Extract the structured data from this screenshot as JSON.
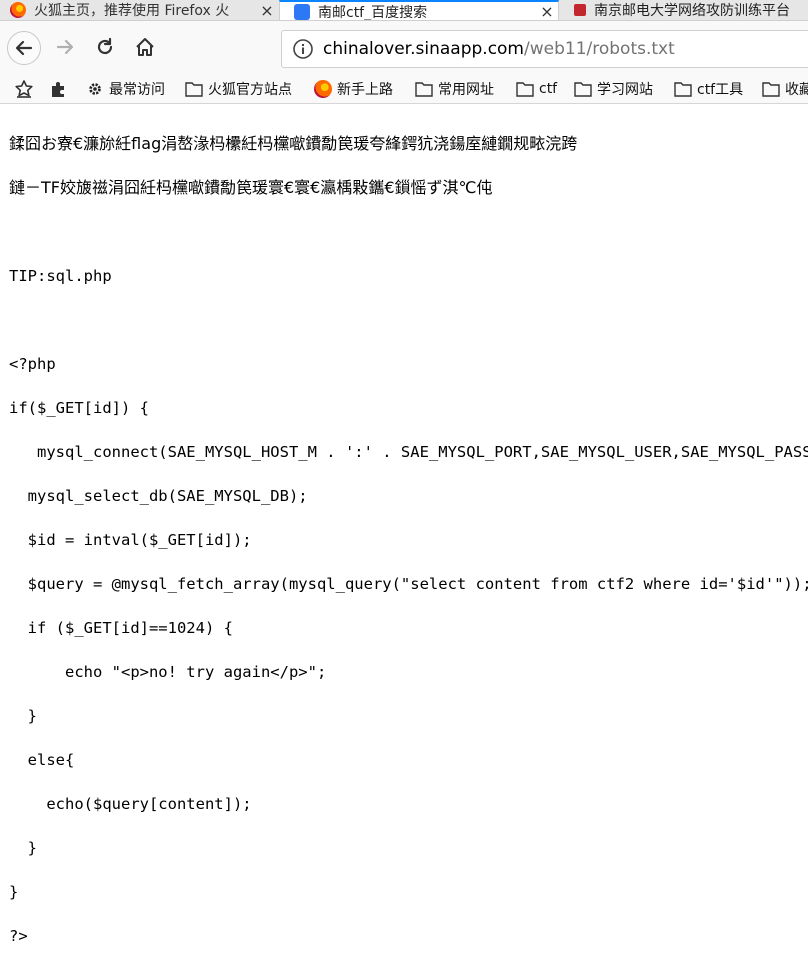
{
  "tabs": [
    {
      "title": "火狐主页，推荐使用 Firefox 火",
      "close": "×",
      "active": false,
      "icon": "firefox-icon"
    },
    {
      "title": "南邮ctf_百度搜索",
      "close": "×",
      "active": true,
      "icon": "baidu-icon"
    },
    {
      "title": "南京邮电大学网络攻防训练平台",
      "active": false,
      "icon": "site-icon"
    }
  ],
  "nav": {
    "url_host": "chinalover.sinaapp.com",
    "url_path": "/web11/robots.txt"
  },
  "bookmarks": [
    {
      "label": "最常访问",
      "icon": "gear-icon"
    },
    {
      "label": "火狐官方站点",
      "icon": "folder-icon"
    },
    {
      "label": "新手上路",
      "icon": "firefox-icon"
    },
    {
      "label": "常用网址",
      "icon": "folder-icon"
    },
    {
      "label": "ctf",
      "icon": "folder-icon"
    },
    {
      "label": "学习网站",
      "icon": "folder-icon"
    },
    {
      "label": "ctf工具",
      "icon": "folder-icon"
    },
    {
      "label": "收藏",
      "icon": "folder-icon"
    }
  ],
  "content": {
    "garbled_line_1": "鍒囧お寮€濂旀紝flag涓嶅湪杩欙紝杩欓噷鐨勪笢瑗夸綘鍔犺浇鍚庢縺鐗规畩浣跨",
    "garbled_line_2": "鏈－TF姣旇禌涓囧紝杩欓噷鐨勪笢瑗寰€寰€瀛楀敤鑴€鎻愮ず淇℃伅",
    "tip": "TIP:sql.php",
    "code": [
      "<?php",
      "if($_GET[id]) {",
      "   mysql_connect(SAE_MYSQL_HOST_M . ':' . SAE_MYSQL_PORT,SAE_MYSQL_USER,SAE_MYSQL_PASS);",
      "  mysql_select_db(SAE_MYSQL_DB);",
      "  $id = intval($_GET[id]);",
      "  $query = @mysql_fetch_array(mysql_query(\"select content from ctf2 where id='$id'\"));",
      "  if ($_GET[id]==1024) {",
      "      echo \"<p>no! try again</p>\";",
      "  }",
      "  else{",
      "    echo($query[content]);",
      "  }",
      "}",
      "?>"
    ]
  }
}
